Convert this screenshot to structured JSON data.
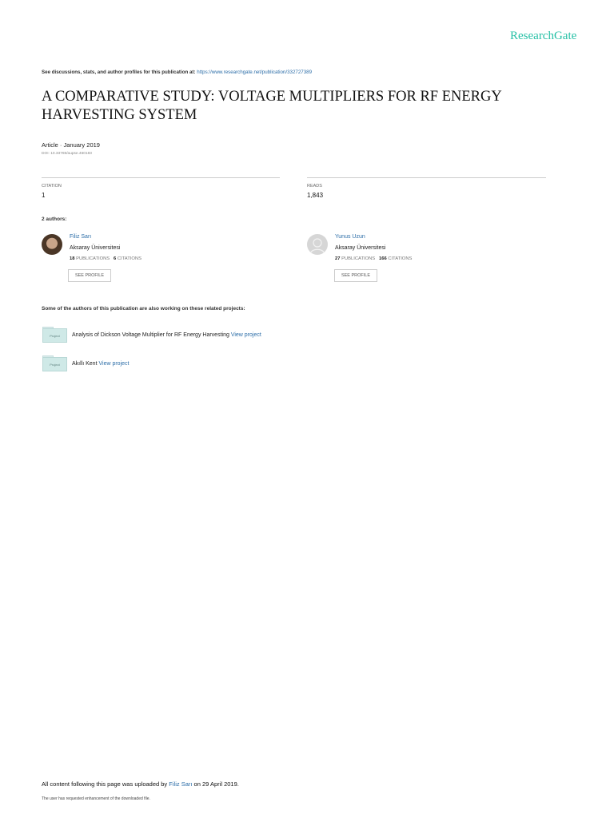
{
  "brand": "ResearchGate",
  "top_line": {
    "text": "See discussions, stats, and author profiles for this publication at:",
    "url": "https://www.researchgate.net/publication/332727389"
  },
  "title": "A COMPARATIVE STUDY: VOLTAGE MULTIPLIERS FOR RF ENERGY HARVESTING SYSTEM",
  "article_meta": "Article · January 2019",
  "doi": "DOI: 10.33769/aupse.460183",
  "citation": {
    "label": "CITATION",
    "value": "1"
  },
  "reads": {
    "label": "READS",
    "value": "1,843"
  },
  "authors_label": "2 authors:",
  "authors": [
    {
      "name": "Filiz Sarı",
      "institution": "Aksaray Üniversitesi",
      "publications": "18",
      "publications_label": "PUBLICATIONS",
      "citations": "6",
      "citations_label": "CITATIONS",
      "button": "SEE PROFILE"
    },
    {
      "name": "Yunus Uzun",
      "institution": "Aksaray Üniversitesi",
      "publications": "27",
      "publications_label": "PUBLICATIONS",
      "citations": "166",
      "citations_label": "CITATIONS",
      "button": "SEE PROFILE"
    }
  ],
  "related_label": "Some of the authors of this publication are also working on these related projects:",
  "projects": [
    {
      "icon_label": "Project",
      "title": "Analysis of Dickson Voltage Multiplier for RF Energy Harvesting",
      "link": "View project"
    },
    {
      "icon_label": "Project",
      "title": "Akıllı Kent",
      "link": "View project"
    }
  ],
  "footer": {
    "prefix": "All content following this page was uploaded by",
    "uploader": "Filiz Sarı",
    "suffix": "on 29 April 2019."
  },
  "footnote": "The user has requested enhancement of the downloaded file."
}
